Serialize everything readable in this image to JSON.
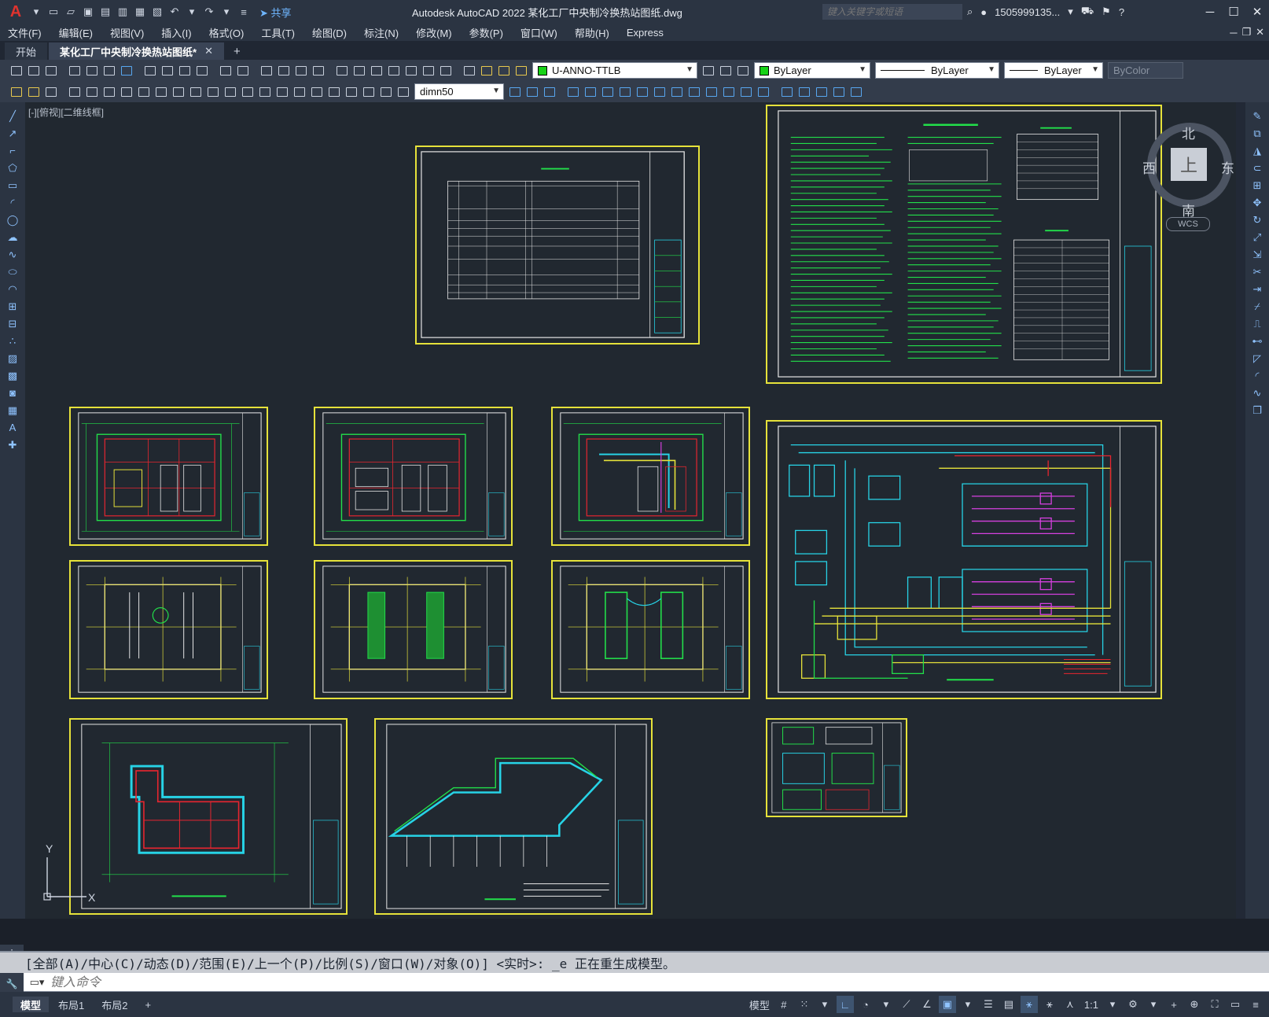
{
  "title": {
    "app_logo": "A",
    "share_label": "共享",
    "text": "Autodesk AutoCAD 2022    某化工厂中央制冷换热站图纸.dwg",
    "search_placeholder": "键入关键字或短语",
    "user": "1505999135...",
    "help": "?"
  },
  "menus": [
    "文件(F)",
    "编辑(E)",
    "视图(V)",
    "插入(I)",
    "格式(O)",
    "工具(T)",
    "绘图(D)",
    "标注(N)",
    "修改(M)",
    "参数(P)",
    "窗口(W)",
    "帮助(H)",
    "Express"
  ],
  "file_tabs": [
    {
      "label": "开始"
    },
    {
      "label": "某化工厂中央制冷换热站图纸*"
    }
  ],
  "toolbar": {
    "layer": "U-ANNO-TTLB",
    "color": "ByLayer",
    "linetype": "ByLayer",
    "lineweight": "ByLayer",
    "plotstyle": "ByColor",
    "dimstyle": "dimn50",
    "layer_color": "#18d218"
  },
  "viewport_label": "[-][俯视][二维线框]",
  "viewcube": {
    "north": "北",
    "south": "南",
    "east": "东",
    "west": "西",
    "top": "上",
    "wcs": "WCS"
  },
  "ucs": {
    "x": "X",
    "y": "Y"
  },
  "command": {
    "history": "[全部(A)/中心(C)/动态(D)/范围(E)/上一个(P)/比例(S)/窗口(W)/对象(O)] <实时>: _e 正在重生成模型。",
    "placeholder": "键入命令"
  },
  "layout_tabs": [
    "模型",
    "布局1",
    "布局2"
  ],
  "status": {
    "model": "模型",
    "scale": "1:1"
  },
  "colors": {
    "canvas": "#212830",
    "sheet_border": "#e6e23a",
    "cad_green": "#22e04a",
    "cad_cyan": "#27d3e6",
    "cad_red": "#e8252f",
    "cad_magenta": "#d640e0"
  }
}
